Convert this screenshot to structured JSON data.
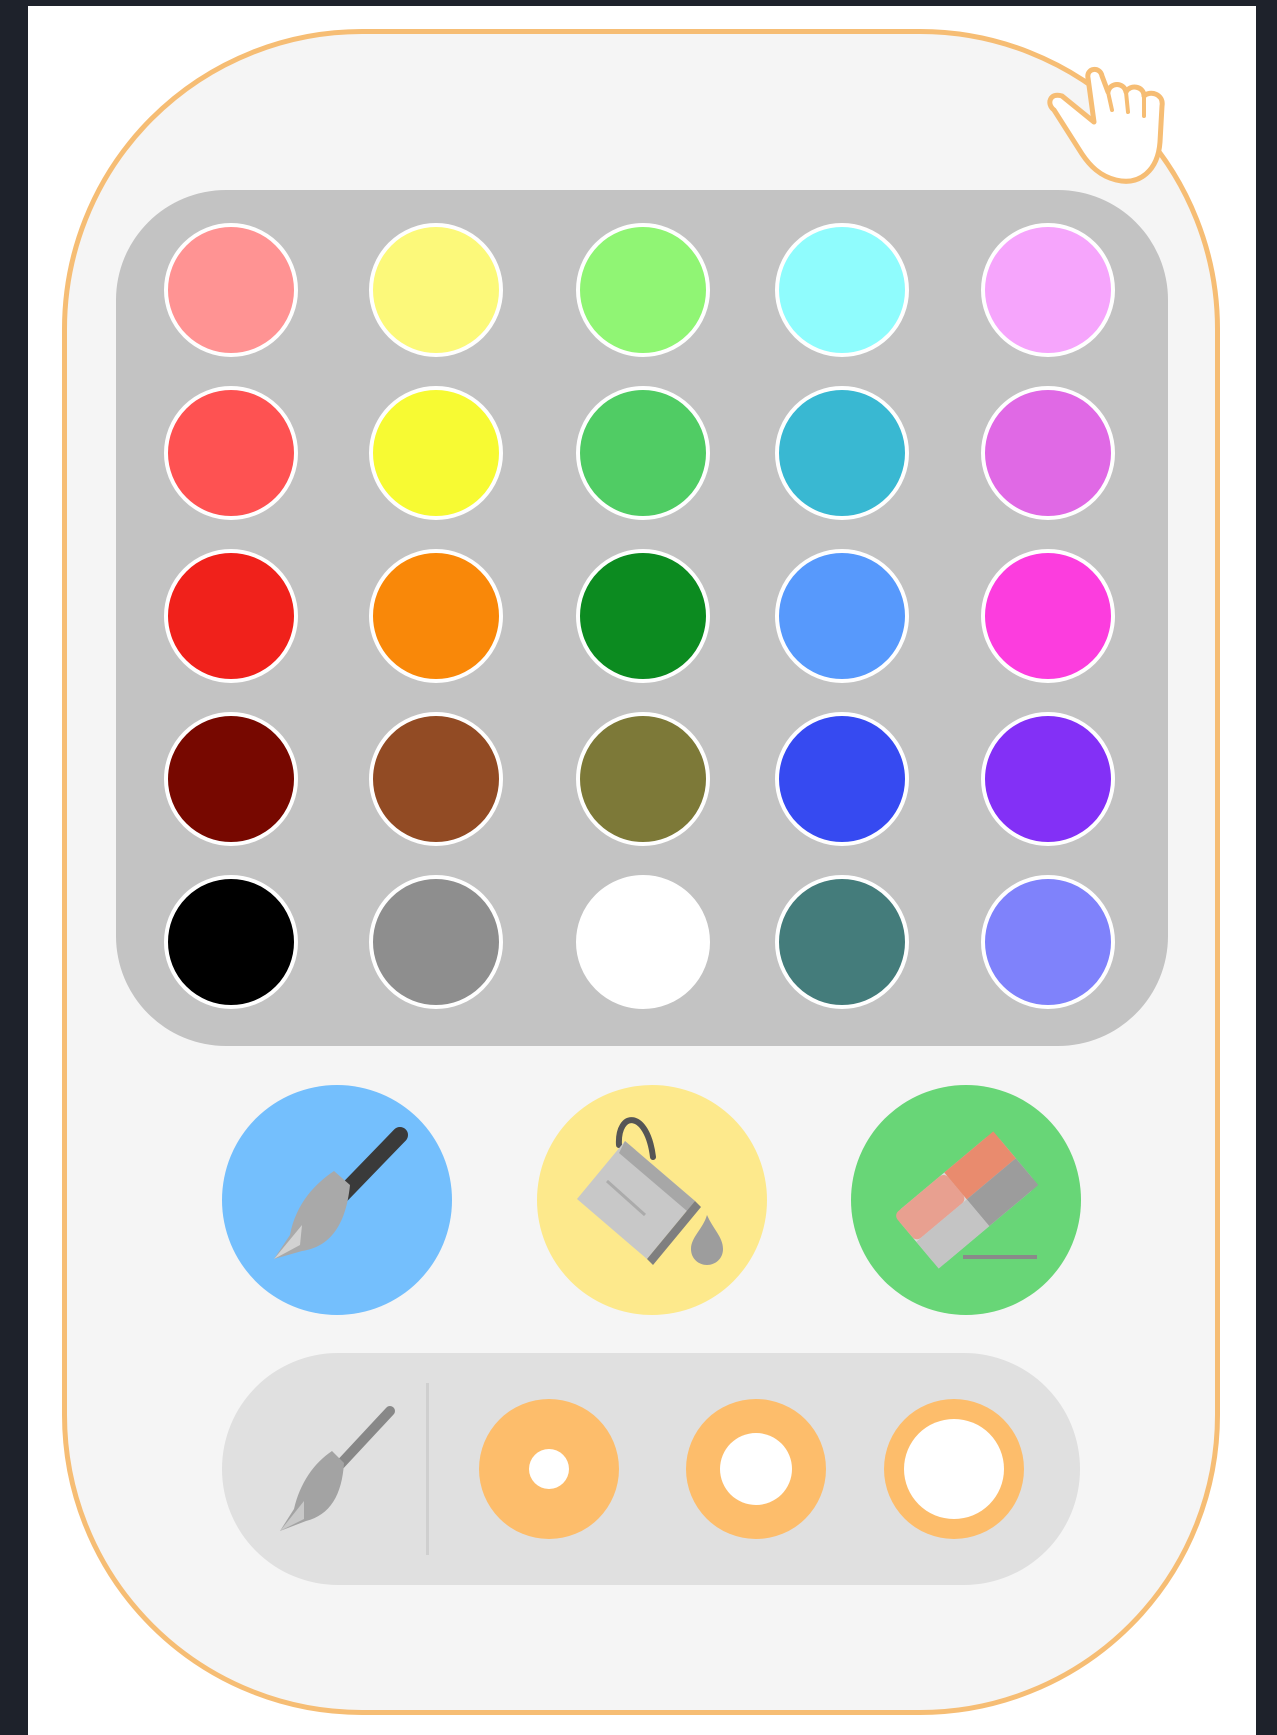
{
  "palette": {
    "swatches": [
      [
        "#ff9393",
        "#fcf97a",
        "#90f574",
        "#8ffcfd",
        "#f6a5fc"
      ],
      [
        "#fe5252",
        "#f7fa33",
        "#50cc64",
        "#39b8d2",
        "#e069e5"
      ],
      [
        "#f0211b",
        "#f98809",
        "#0c8b20",
        "#5799fc",
        "#fc3dde"
      ],
      [
        "#770800",
        "#924b24",
        "#7d7938",
        "#364af1",
        "#8330f6"
      ],
      [
        "#000000",
        "#8e8e8e",
        "#ffffff",
        "#447c7b",
        "#7f82fb"
      ]
    ]
  },
  "tools": {
    "brush": {
      "icon": "paintbrush-icon",
      "color": "#74bffd"
    },
    "fill": {
      "icon": "paint-bucket-icon",
      "color": "#fde98c"
    },
    "eraser": {
      "icon": "eraser-icon",
      "color": "#68d677"
    }
  },
  "brush_size": {
    "icon": "paintbrush-icon",
    "options": [
      "small",
      "medium",
      "large"
    ],
    "accent": "#fdbd6b"
  },
  "cursor": {
    "icon": "hand-pointer-icon"
  }
}
